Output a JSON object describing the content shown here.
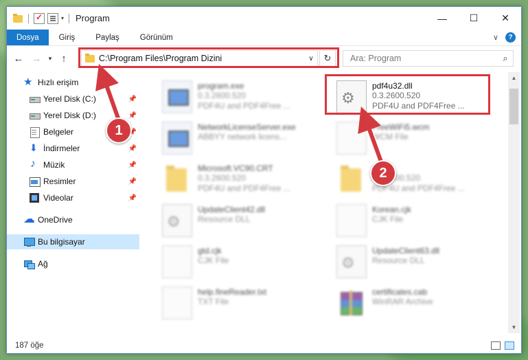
{
  "titlebar": {
    "title": "Program",
    "minimize": "—",
    "maximize": "☐",
    "close": "✕"
  },
  "ribbon": {
    "tabs": [
      "Dosya",
      "Giriş",
      "Paylaş",
      "Görünüm"
    ],
    "help": "?"
  },
  "nav": {
    "back": "←",
    "forward": "→",
    "up": "↑",
    "dropdown": "∨"
  },
  "address": {
    "path": "C:\\Program Files\\Program Dizini",
    "refresh": "↻"
  },
  "search": {
    "placeholder": "Ara: Program",
    "icon": "search-icon"
  },
  "sidebar": {
    "items": [
      {
        "label": "Hızlı erişim",
        "icon": "star-icon"
      },
      {
        "label": "Yerel Disk (C:)",
        "icon": "disk-icon",
        "pinned": true
      },
      {
        "label": "Yerel Disk (D:)",
        "icon": "disk-icon",
        "pinned": true
      },
      {
        "label": "Belgeler",
        "icon": "documents-icon",
        "pinned": true
      },
      {
        "label": "İndirmeler",
        "icon": "download-icon",
        "pinned": true
      },
      {
        "label": "Müzik",
        "icon": "music-icon",
        "pinned": true
      },
      {
        "label": "Resimler",
        "icon": "pictures-icon",
        "pinned": true
      },
      {
        "label": "Videolar",
        "icon": "videos-icon",
        "pinned": true
      },
      {
        "label": "OneDrive",
        "icon": "cloud-icon"
      },
      {
        "label": "Bu bilgisayar",
        "icon": "computer-icon",
        "selected": true
      },
      {
        "label": "Ağ",
        "icon": "network-icon"
      }
    ]
  },
  "files": [
    {
      "name": "program.exe",
      "line1": "0.3.2600.520",
      "line2": "PDF4U and PDF4Free ...",
      "type": "exe"
    },
    {
      "name": "pdf4u32.dll",
      "line1": "0.3.2600.520",
      "line2": "PDF4U and PDF4Free ...",
      "type": "dll"
    },
    {
      "name": "NetworkLicenseServer.exe",
      "line1": "ABBYY network licens...",
      "line2": "",
      "type": "exe"
    },
    {
      "name": "FreeWiFi5.wcm",
      "line1": "WCM File",
      "line2": "",
      "type": "file"
    },
    {
      "name": "Microsoft.VC90.CRT",
      "line1": "0.3.2600.520",
      "line2": "PDF4U and PDF4Free ...",
      "type": "folder"
    },
    {
      "name": "x64",
      "line1": "0.3.2600.520",
      "line2": "PDF4U and PDF4Free ...",
      "type": "folder"
    },
    {
      "name": "UpdateClient42.dll",
      "line1": "Resource DLL",
      "line2": "",
      "type": "dll"
    },
    {
      "name": "Korean.cjk",
      "line1": "CJK File",
      "line2": "",
      "type": "file"
    },
    {
      "name": "gtd.cjk",
      "line1": "CJK File",
      "line2": "",
      "type": "file"
    },
    {
      "name": "UpdateClient63.dll",
      "line1": "Resource DLL",
      "line2": "",
      "type": "dll"
    },
    {
      "name": "help.fineReader.txt",
      "line1": "TXT File",
      "line2": "",
      "type": "file"
    },
    {
      "name": "certificates.cab",
      "line1": "WinRAR Archive",
      "line2": "",
      "type": "rar"
    }
  ],
  "status": {
    "count": "187 öğe"
  },
  "annotations": {
    "badge1": "1",
    "badge2": "2"
  },
  "colors": {
    "highlight": "#d9363e",
    "accent": "#1979ca",
    "selected_bg": "#cce8ff"
  }
}
